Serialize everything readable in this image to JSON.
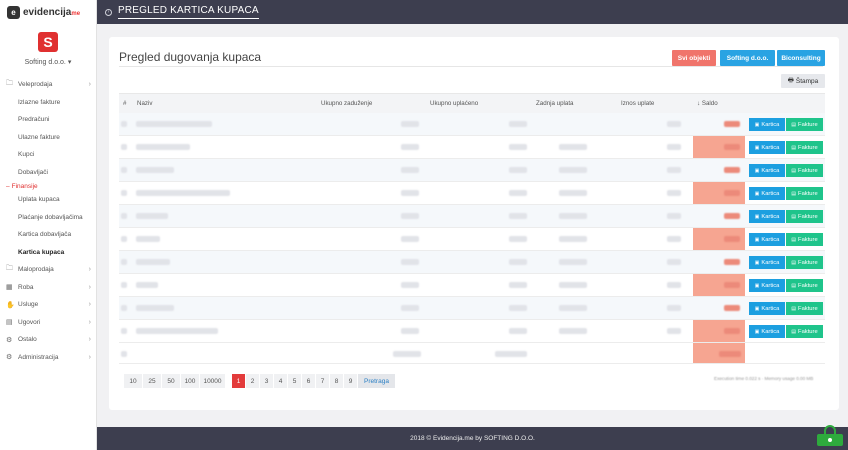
{
  "brand": {
    "name": "evidencija",
    "suffix": "me"
  },
  "company": "Softing d.o.o.",
  "sidebar": {
    "items": [
      {
        "label": "Veleprodaja",
        "icon": "folder-icon",
        "has_children": true
      },
      {
        "label": "Izlazne fakture",
        "sub": true
      },
      {
        "label": "Predračuni",
        "sub": true
      },
      {
        "label": "Ulazne fakture",
        "sub": true
      },
      {
        "label": "Kupci",
        "sub": true
      },
      {
        "label": "Dobavljači",
        "sub": true
      },
      {
        "label": "Finansije",
        "subhead": true
      },
      {
        "label": "Uplata kupaca",
        "sub": true
      },
      {
        "label": "Plaćanje dobavljačima",
        "sub": true
      },
      {
        "label": "Kartica dobavljača",
        "sub": true
      },
      {
        "label": "Kartica kupaca",
        "sub": true,
        "active": true
      },
      {
        "label": "Maloprodaja",
        "icon": "folder-icon",
        "has_children": true
      },
      {
        "label": "Roba",
        "icon": "box-icon",
        "has_children": true
      },
      {
        "label": "Usluge",
        "icon": "hand-icon",
        "has_children": true
      },
      {
        "label": "Ugovori",
        "icon": "calendar-icon",
        "has_children": true
      },
      {
        "label": "Ostalo",
        "icon": "gear-icon",
        "has_children": true
      },
      {
        "label": "Administracija",
        "icon": "gears-icon",
        "has_children": true
      }
    ]
  },
  "topbar": {
    "title": "PREGLED KARTICA KUPACA"
  },
  "card": {
    "title": "Pregled dugovanja kupaca",
    "objects": [
      "Svi objekti",
      "Softing d.o.o.",
      "Biconsulting"
    ],
    "print_label": "Štampa"
  },
  "table": {
    "headers": {
      "num": "#",
      "name": "Naziv",
      "debt": "Ukupno zaduženje",
      "paid": "Ukupno uplaćeno",
      "last": "Zadnja uplata",
      "amount": "Iznos uplate",
      "saldo": "↓ Saldo"
    },
    "row_count": 10,
    "kartica_label": "Kartica",
    "fakture_label": "Fakture"
  },
  "pager": {
    "sizes": [
      "10",
      "25",
      "50",
      "100",
      "10000"
    ],
    "pages": [
      "1",
      "2",
      "3",
      "4",
      "5",
      "6",
      "7",
      "8",
      "9"
    ],
    "active_page": "1",
    "more_label": "Pretraga"
  },
  "footer": {
    "text": "2018 © Evidencija.me by SOFTING D.O.O."
  },
  "colors": {
    "accent_red": "#e33b3b",
    "topbar": "#3d3e4f",
    "blue": "#1c9fe0",
    "green": "#1fc48b",
    "saldo": "#f6a591"
  }
}
